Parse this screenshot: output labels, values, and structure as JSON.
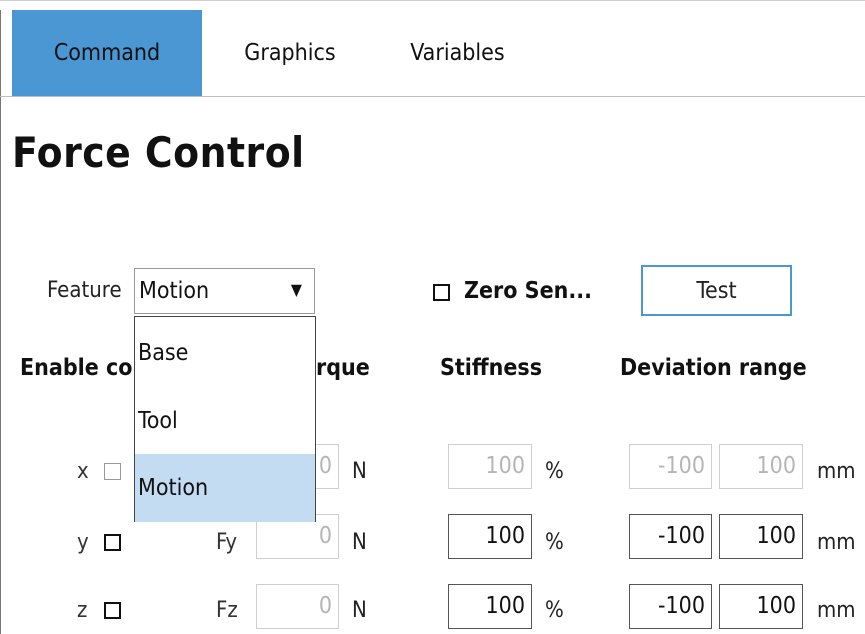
{
  "tabs": [
    {
      "label": "Command",
      "active": true
    },
    {
      "label": "Graphics",
      "active": false
    },
    {
      "label": "Variables",
      "active": false
    }
  ],
  "title": "Force Control",
  "feature": {
    "label": "Feature",
    "selected": "Motion",
    "options": [
      "Base",
      "Tool",
      "Motion"
    ]
  },
  "zero_sensor": {
    "label": "Zero Sen...",
    "checked": false
  },
  "test_button": "Test",
  "headers": {
    "enable": "Enable co",
    "torque": "rque",
    "stiffness": "Stiffness",
    "deviation": "Deviation range"
  },
  "rows": [
    {
      "axis": "x",
      "force_label": "",
      "force_value": "0",
      "force_unit": "N",
      "stiffness": "100",
      "stiffness_unit": "%",
      "dev_min": "-100",
      "dev_max": "100",
      "dev_unit": "mm"
    },
    {
      "axis": "y",
      "force_label": "Fy",
      "force_value": "0",
      "force_unit": "N",
      "stiffness": "100",
      "stiffness_unit": "%",
      "dev_min": "-100",
      "dev_max": "100",
      "dev_unit": "mm"
    },
    {
      "axis": "z",
      "force_label": "Fz",
      "force_value": "0",
      "force_unit": "N",
      "stiffness": "100",
      "stiffness_unit": "%",
      "dev_min": "-100",
      "dev_max": "100",
      "dev_unit": "mm"
    }
  ],
  "colors": {
    "accent": "#4a97d3",
    "selected_option": "#c4dcf2"
  }
}
